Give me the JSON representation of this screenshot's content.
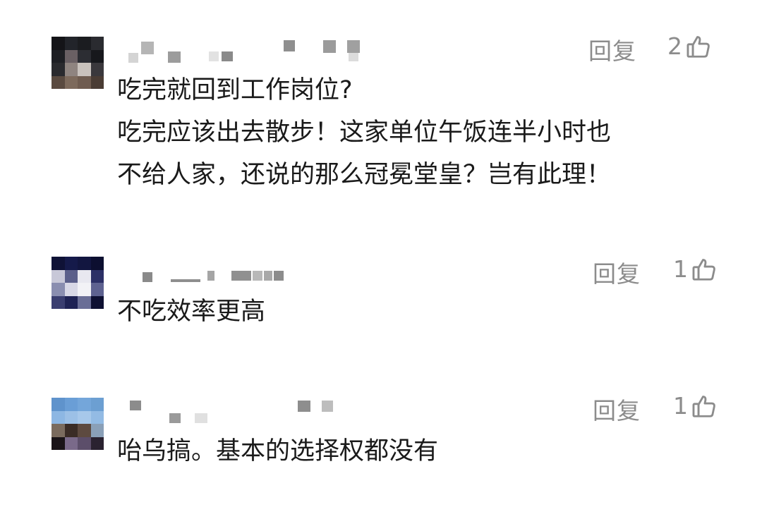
{
  "comments": [
    {
      "reply_label": "回复",
      "like_count": "2",
      "lines": [
        "吃完就回到工作岗位?",
        "吃完应该出去散步！这家单位午饭连半小时也",
        "不给人家，还说的那么冠冕堂皇？岂有此理！"
      ]
    },
    {
      "reply_label": "回复",
      "like_count": "1",
      "lines": [
        "不吃效率更高"
      ]
    },
    {
      "reply_label": "回复",
      "like_count": "1",
      "lines": [
        "咍乌搞。基本的选择权都没有"
      ]
    }
  ],
  "icons": {
    "like": "thumbs-up-outline-icon"
  },
  "colors": {
    "text": "#1a1a1a",
    "meta": "#8c8c8c",
    "background": "#ffffff"
  }
}
